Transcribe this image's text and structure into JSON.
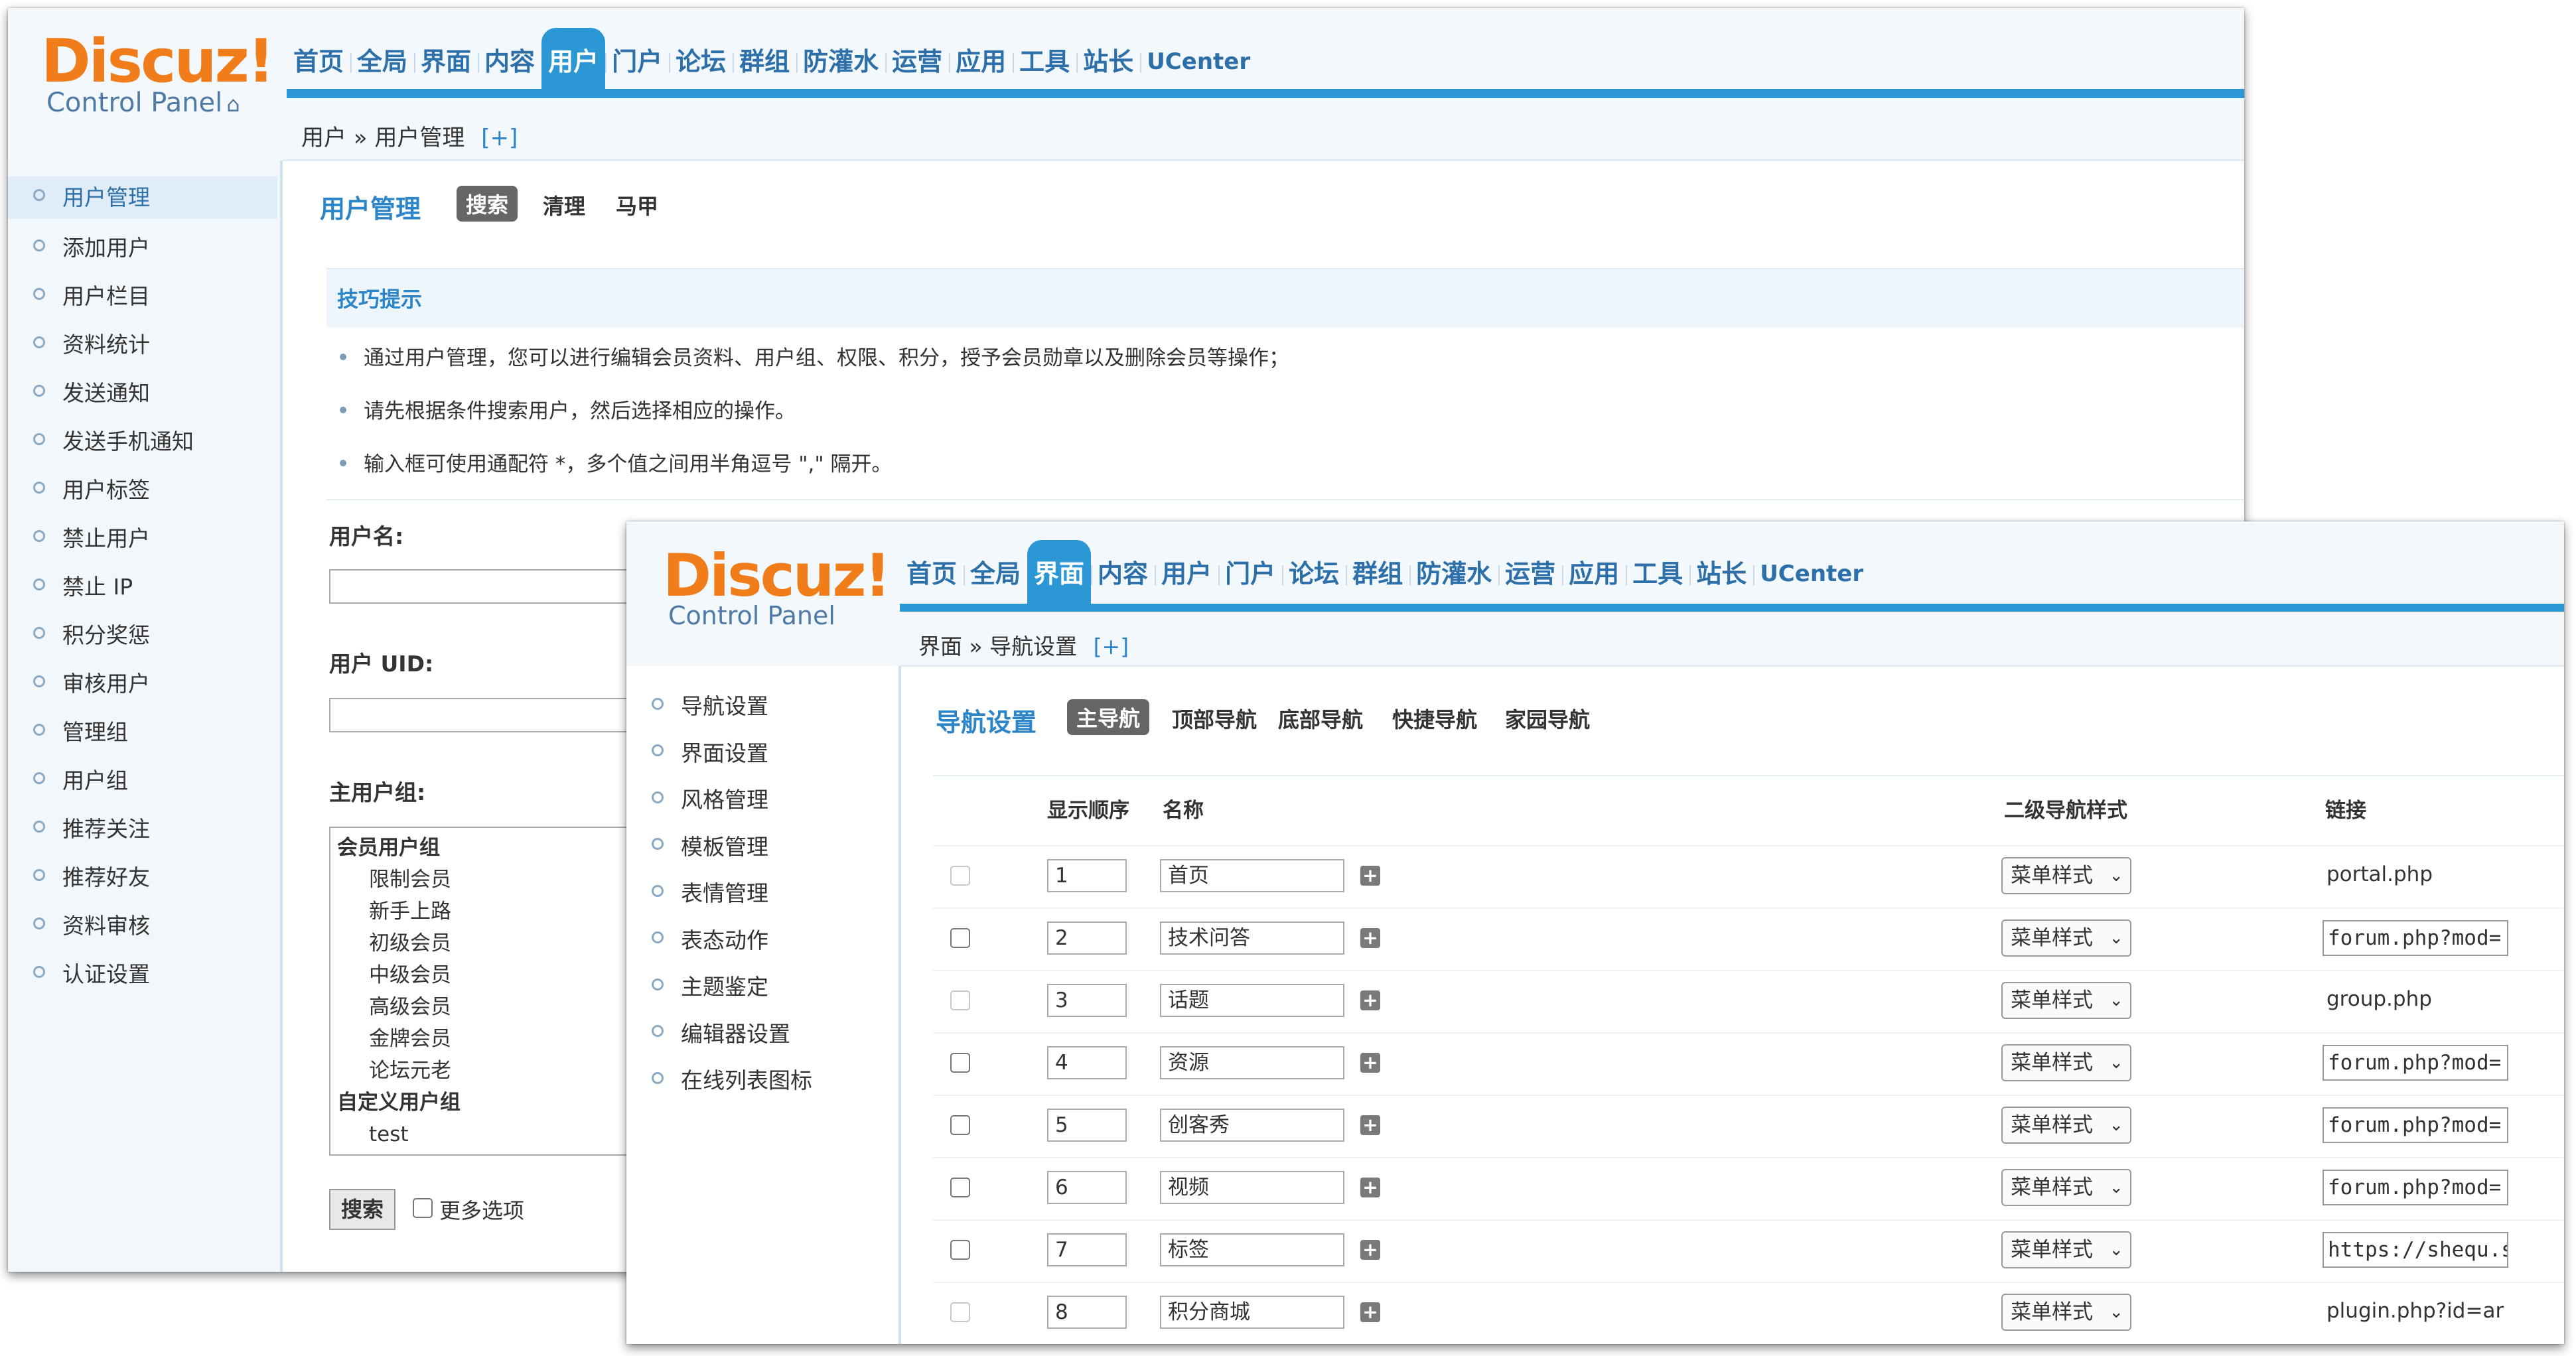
{
  "colors": {
    "accent": "#2b97d4",
    "title_blue": "#2b85c8",
    "logo_orange": "#f07c1a"
  },
  "logo": {
    "brand": "Discuz!",
    "sub": "Control Panel"
  },
  "window_a": {
    "nav": [
      "首页",
      "全局",
      "界面",
      "内容",
      "用户",
      "门户",
      "论坛",
      "群组",
      "防灌水",
      "运营",
      "应用",
      "工具",
      "站长",
      "UCenter"
    ],
    "active_nav": "用户",
    "breadcrumb": {
      "path": "用户 » 用户管理",
      "add": "[+]"
    },
    "sidebar": [
      "用户管理",
      "添加用户",
      "用户栏目",
      "资料统计",
      "发送通知",
      "发送手机通知",
      "用户标签",
      "禁止用户",
      "禁止 IP",
      "积分奖惩",
      "审核用户",
      "管理组",
      "用户组",
      "推荐关注",
      "推荐好友",
      "资料审核",
      "认证设置"
    ],
    "title": "用户管理",
    "tabs": [
      "搜索",
      "清理",
      "马甲"
    ],
    "tips_title": "技巧提示",
    "tips": [
      "通过用户管理，您可以进行编辑会员资料、用户组、权限、积分，授予会员勋章以及删除会员等操作；",
      "请先根据条件搜索用户，然后选择相应的操作。",
      "输入框可使用通配符 *，多个值之间用半角逗号 \",\" 隔开。"
    ],
    "labels": {
      "username": "用户名:",
      "uid": "用户 UID:",
      "group": "主用户组:"
    },
    "group_list": [
      {
        "text": "会员用户组",
        "type": "grp"
      },
      {
        "text": "限制会员",
        "type": "sub"
      },
      {
        "text": "新手上路",
        "type": "sub"
      },
      {
        "text": "初级会员",
        "type": "sub"
      },
      {
        "text": "中级会员",
        "type": "sub"
      },
      {
        "text": "高级会员",
        "type": "sub"
      },
      {
        "text": "金牌会员",
        "type": "sub"
      },
      {
        "text": "论坛元老",
        "type": "sub"
      },
      {
        "text": "自定义用户组",
        "type": "grp"
      },
      {
        "text": "test",
        "type": "sub"
      }
    ],
    "search_button": "搜索",
    "more_options": "更多选项"
  },
  "window_b": {
    "nav": [
      "首页",
      "全局",
      "界面",
      "内容",
      "用户",
      "门户",
      "论坛",
      "群组",
      "防灌水",
      "运营",
      "应用",
      "工具",
      "站长",
      "UCenter"
    ],
    "active_nav": "界面",
    "breadcrumb": {
      "path": "界面 » 导航设置",
      "add": "[+]"
    },
    "sidebar": [
      "导航设置",
      "界面设置",
      "风格管理",
      "模板管理",
      "表情管理",
      "表态动作",
      "主题鉴定",
      "编辑器设置",
      "在线列表图标"
    ],
    "title": "导航设置",
    "tabs": [
      "主导航",
      "顶部导航",
      "底部导航",
      "快捷导航",
      "家园导航"
    ],
    "columns": {
      "order": "显示顺序",
      "name": "名称",
      "style": "二级导航样式",
      "link": "链接"
    },
    "rows": [
      {
        "order": "1",
        "name": "首页",
        "style": "菜单样式",
        "link": "portal.php",
        "editable": false
      },
      {
        "order": "2",
        "name": "技术问答",
        "style": "菜单样式",
        "link": "forum.php?mod=",
        "editable": true
      },
      {
        "order": "3",
        "name": "话题",
        "style": "菜单样式",
        "link": "group.php",
        "editable": false
      },
      {
        "order": "4",
        "name": "资源",
        "style": "菜单样式",
        "link": "forum.php?mod=",
        "editable": true
      },
      {
        "order": "5",
        "name": "创客秀",
        "style": "菜单样式",
        "link": "forum.php?mod=",
        "editable": true
      },
      {
        "order": "6",
        "name": "视频",
        "style": "菜单样式",
        "link": "forum.php?mod=",
        "editable": true
      },
      {
        "order": "7",
        "name": "标签",
        "style": "菜单样式",
        "link": "https://shequ.str",
        "editable": true
      },
      {
        "order": "8",
        "name": "积分商城",
        "style": "菜单样式",
        "link": "plugin.php?id=ar",
        "editable": false
      }
    ]
  }
}
